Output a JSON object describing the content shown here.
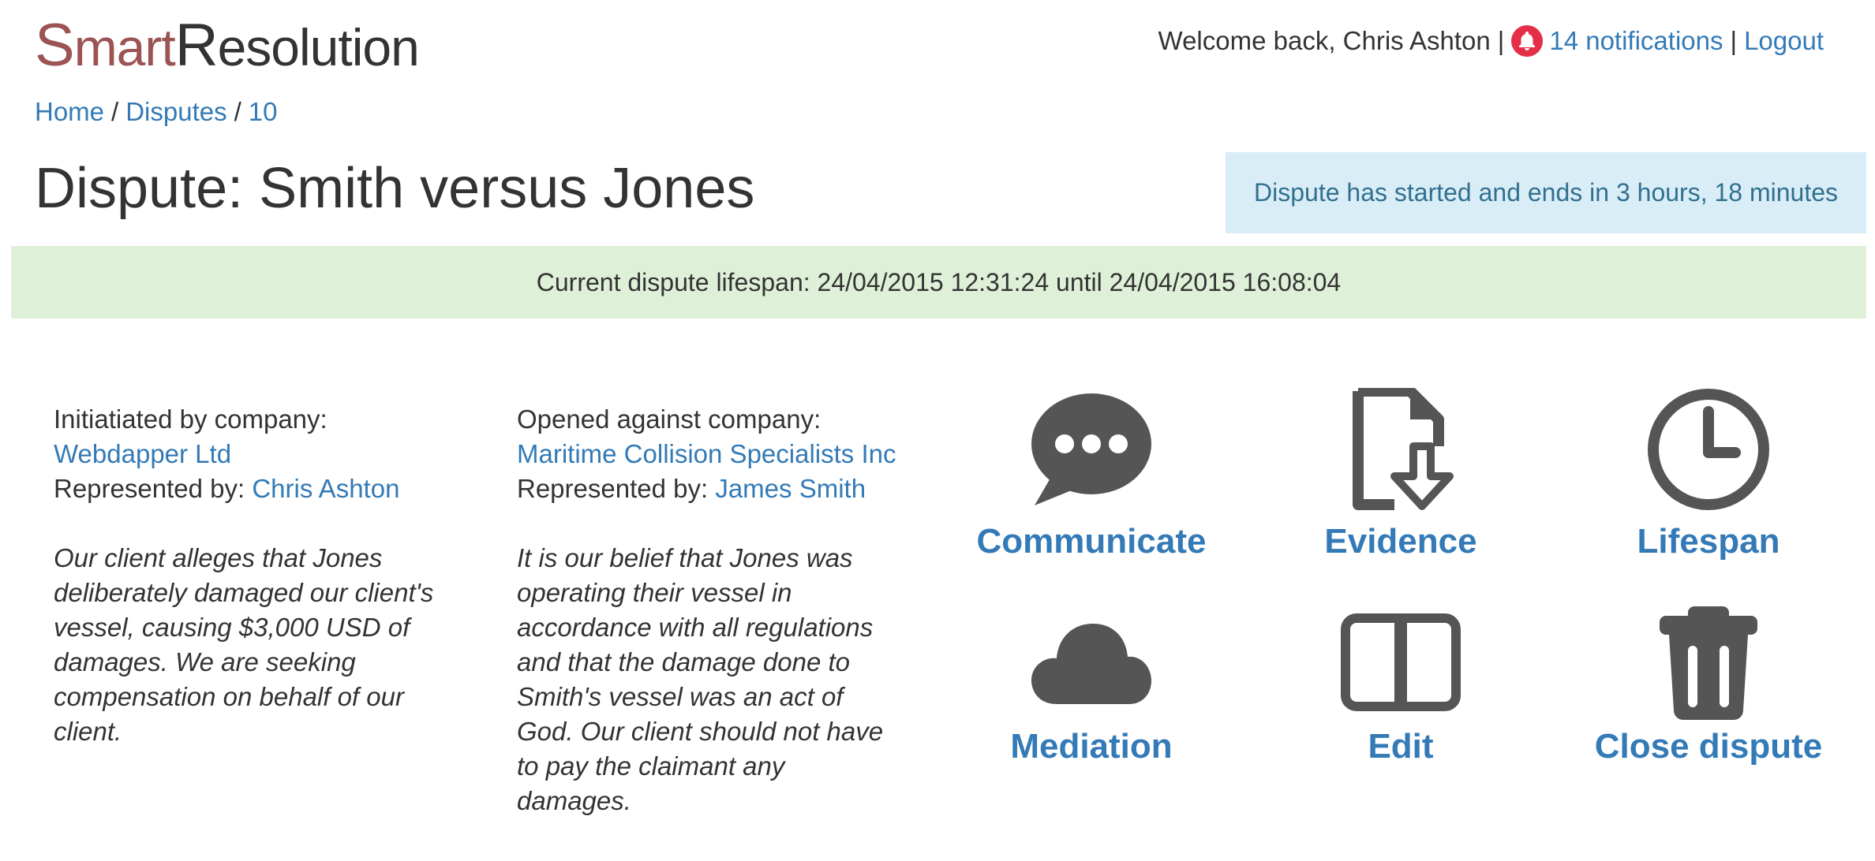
{
  "brand": {
    "part1_initial": "S",
    "part1_rest": "mart",
    "part2_initial": "R",
    "part2_rest": "esolution"
  },
  "topnav": {
    "welcome": "Welcome back, Chris Ashton",
    "separator": "|",
    "notifications": "14 notifications",
    "logout": "Logout",
    "bell_color": "#e52f47"
  },
  "breadcrumb": {
    "items": [
      "Home",
      "Disputes",
      "10"
    ],
    "separator": "/"
  },
  "page_title": "Dispute: Smith versus Jones",
  "status_alert": "Dispute has started and ends in 3 hours, 18 minutes",
  "lifespan_alert": "Current dispute lifespan: 24/04/2015 12:31:24 until 24/04/2015 16:08:04",
  "party_a": {
    "heading": "Initiatiated by company:",
    "company": "Webdapper Ltd",
    "rep_label": "Represented by:",
    "rep_name": "Chris Ashton",
    "statement": "Our client alleges that Jones deliberately damaged our client's vessel, causing $3,000 USD of damages. We are seeking compensation on behalf of our client."
  },
  "party_b": {
    "heading": "Opened against company:",
    "company": "Maritime Collision Specialists Inc",
    "rep_label": "Represented by:",
    "rep_name": "James Smith",
    "statement": "It is our belief that Jones was operating their vessel in accordance with all regulations and that the damage done to Smith's vessel was an act of God. Our client should not have to pay the claimant any damages."
  },
  "actions": {
    "communicate": {
      "label": "Communicate",
      "icon": "speech-bubble-icon"
    },
    "evidence": {
      "label": "Evidence",
      "icon": "file-download-icon"
    },
    "lifespan": {
      "label": "Lifespan",
      "icon": "clock-icon"
    },
    "mediation": {
      "label": "Mediation",
      "icon": "cloud-icon"
    },
    "edit": {
      "label": "Edit",
      "icon": "book-icon"
    },
    "close": {
      "label": "Close dispute",
      "icon": "trash-icon"
    }
  },
  "colors": {
    "link": "#337ab7",
    "icon": "#555555",
    "brand_red": "#9b5354",
    "info_bg": "#d9edf7",
    "success_bg": "#dff0d8"
  }
}
